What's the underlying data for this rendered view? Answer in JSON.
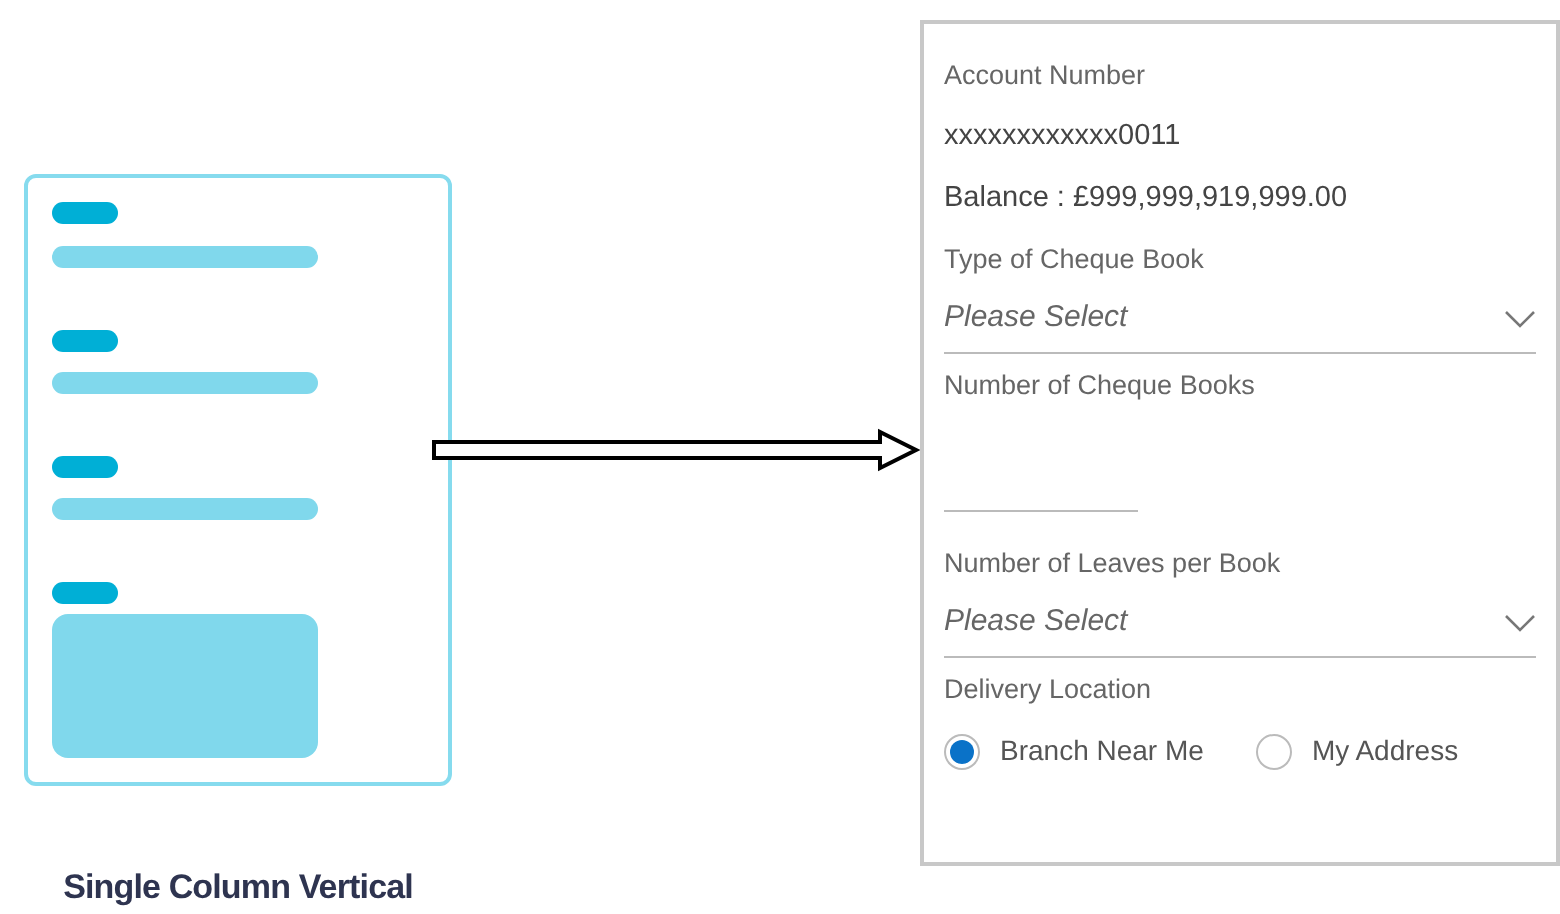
{
  "layout_preview": {
    "caption": "Single Column Vertical"
  },
  "form": {
    "items": [
      {
        "kind": "label",
        "text": "Account Number"
      },
      {
        "kind": "value",
        "text": "xxxxxxxxxxxx0011"
      },
      {
        "kind": "value",
        "text": "Balance : £999,999,919,999.00"
      },
      {
        "kind": "select",
        "label": "Type of Cheque Book",
        "placeholder": "Please Select"
      },
      {
        "kind": "input",
        "label": "Number of Cheque Books"
      },
      {
        "kind": "select",
        "label": "Number of Leaves per Book",
        "placeholder": "Please Select"
      },
      {
        "kind": "radio",
        "label": "Delivery Location",
        "options": [
          {
            "label": "Branch Near Me",
            "selected": true
          },
          {
            "label": "My Address",
            "selected": false
          }
        ]
      }
    ]
  }
}
